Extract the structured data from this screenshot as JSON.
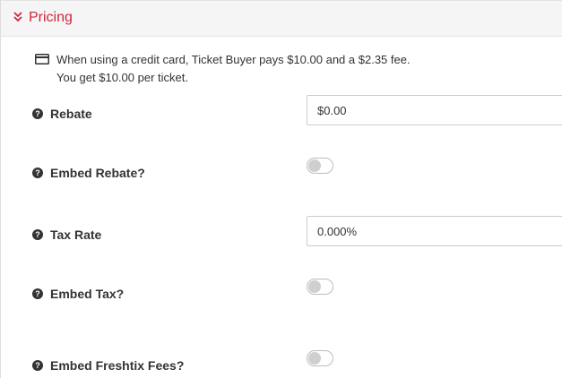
{
  "section": {
    "title": "Pricing",
    "accent_color": "#d0283c",
    "collapse_icon": "chevron-double-down-icon"
  },
  "info": {
    "icon": "credit-card-icon",
    "line1": "When using a credit card, Ticket Buyer pays $10.00 and a $2.35 fee.",
    "line2": "You get $10.00 per ticket."
  },
  "fields": {
    "rebate": {
      "label": "Rebate",
      "value": "$0.00"
    },
    "embed_rebate": {
      "label": "Embed Rebate?",
      "checked": false
    },
    "tax_rate": {
      "label": "Tax Rate",
      "value": "0.000%"
    },
    "embed_tax": {
      "label": "Embed Tax?",
      "checked": false
    },
    "embed_fees": {
      "label": "Embed Freshtix Fees?",
      "checked": false
    }
  },
  "help_icon_glyph": "?"
}
